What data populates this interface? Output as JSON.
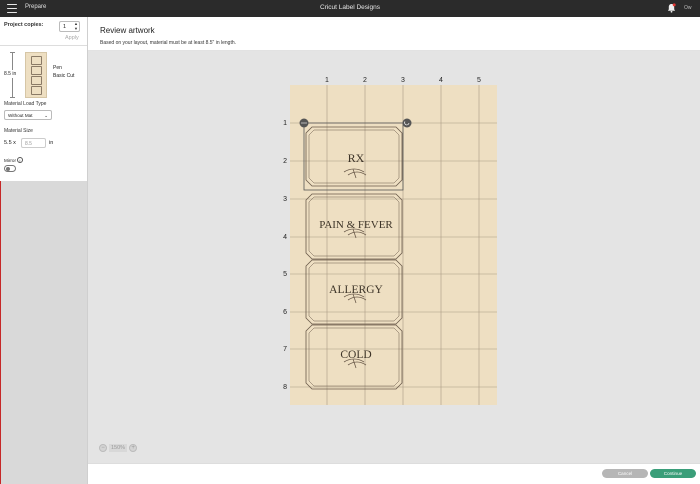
{
  "topbar": {
    "section": "Prepare",
    "app_title": "Cricut Label Designs",
    "user": "Ow"
  },
  "left_panel": {
    "copies_label": "Project copies:",
    "copies_value": "1",
    "apply_label": "Apply",
    "mat_length": "8.5 in",
    "tool_1": "Pen",
    "tool_2": "Basic Cut",
    "material_load_label": "Material Load Type",
    "material_load_value": "Without Mat",
    "material_size_label": "Material Size",
    "width_value": "5.5 x",
    "height_value": "8.5",
    "unit": "in",
    "mirror_label": "Mirror"
  },
  "main": {
    "title": "Review artwork",
    "note": "Based on your layout, material must be at least 8.5\" in length.",
    "ruler_top": [
      "1",
      "2",
      "3",
      "4",
      "5"
    ],
    "ruler_left": [
      "1",
      "2",
      "3",
      "4",
      "5",
      "6",
      "7",
      "8"
    ],
    "labels": [
      "RX",
      "PAIN & FEVER",
      "ALLERGY",
      "COLD"
    ],
    "zoom": "150%",
    "zoom_minus": "−",
    "zoom_plus": "+"
  },
  "buttons": {
    "cancel": "Cancel",
    "continue": "Continue"
  },
  "colors": {
    "mat": "#eedfc2",
    "grid": "#a89a84",
    "accent": "#3a9e79"
  }
}
